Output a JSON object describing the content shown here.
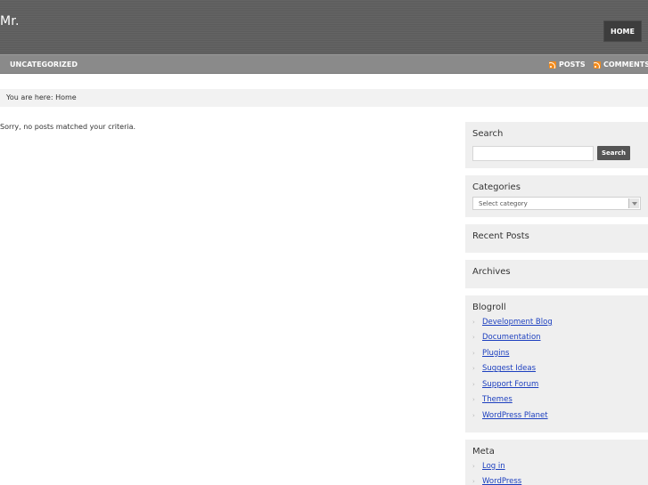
{
  "header": {
    "site_title": "Mr.",
    "home_label": "HOME"
  },
  "subnav": {
    "category_label": "UNCATEGORIZED",
    "posts_feed_label": "POSTS",
    "comments_feed_label": "COMMENTS",
    "feed_icon": "rss-icon"
  },
  "breadcrumb": {
    "text": "You are here: Home"
  },
  "content": {
    "message": "Sorry, no posts matched your criteria."
  },
  "sidebar": {
    "search": {
      "title": "Search",
      "input_value": "",
      "button_label": "Search"
    },
    "categories": {
      "title": "Categories",
      "selected": "Select category"
    },
    "recent_posts": {
      "title": "Recent Posts"
    },
    "archives": {
      "title": "Archives"
    },
    "blogroll": {
      "title": "Blogroll",
      "links": [
        "Development Blog",
        "Documentation",
        "Plugins",
        "Suggest Ideas",
        "Support Forum",
        "Themes",
        "WordPress Planet"
      ]
    },
    "meta": {
      "title": "Meta",
      "links": [
        "Log in",
        "WordPress"
      ]
    }
  },
  "colors": {
    "header_bg": "#5f5f5f",
    "subnav_bg": "#8a8a8a",
    "widget_bg": "#efefef",
    "link": "#1c3fbf",
    "rss": "#f28a1a"
  }
}
